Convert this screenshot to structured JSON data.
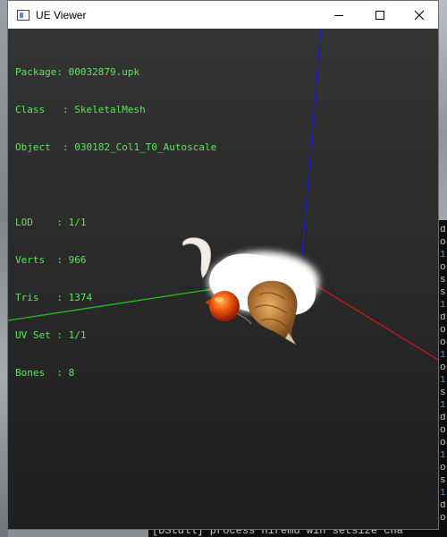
{
  "window": {
    "title": "UE Viewer",
    "icon": "app-window-icon",
    "controls": [
      "minimize-icon",
      "maximize-icon",
      "close-icon"
    ]
  },
  "info": {
    "package": {
      "key": "Package",
      "value": "00032879.upk"
    },
    "class": {
      "key": "Class",
      "value": "SkeletalMesh"
    },
    "object": {
      "key": "Object",
      "value": "030182_Col1_T0_Autoscale"
    },
    "lod": {
      "key": "LOD",
      "value": "1/1"
    },
    "verts": {
      "key": "Verts",
      "value": "966"
    },
    "tris": {
      "key": "Tris",
      "value": "1374"
    },
    "uvset": {
      "key": "UV Set",
      "value": "1/1"
    },
    "bones": {
      "key": "Bones",
      "value": "8"
    }
  },
  "background_console": {
    "bottom_line": "[DStdll] process  hiremu win setsize cha",
    "fragments": [
      "d",
      "o",
      "1",
      "o",
      "s",
      "s",
      "1",
      "d",
      "o",
      "o",
      "1",
      "o",
      "1",
      "s",
      "1",
      "d",
      "o",
      "o",
      "1",
      "o",
      "s",
      "1",
      "d",
      "o"
    ]
  },
  "colors": {
    "info_text": "#5fe35f",
    "axis_x": "#d01818",
    "axis_y": "#22c022",
    "axis_z": "#1a1ad6",
    "viewport_bg": "#2a2a2a"
  }
}
